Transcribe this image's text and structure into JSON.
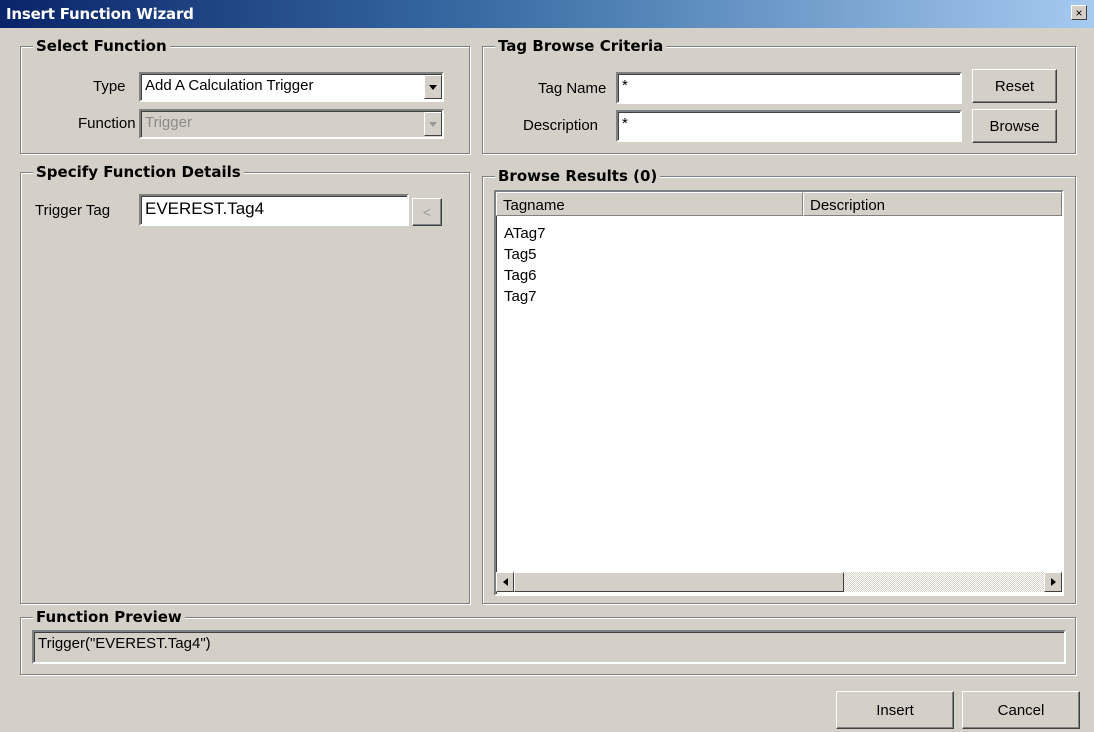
{
  "window": {
    "title": "Insert Function Wizard",
    "close_glyph": "×"
  },
  "select_function": {
    "heading": "Select Function",
    "type_label": "Type",
    "type_value": "Add A Calculation Trigger",
    "function_label": "Function",
    "function_value": "Trigger"
  },
  "tag_browse": {
    "heading": "Tag Browse Criteria",
    "tag_name_label": "Tag Name",
    "tag_name_value": "*",
    "description_label": "Description",
    "description_value": "*",
    "reset_label": "Reset",
    "browse_label": "Browse"
  },
  "function_details": {
    "heading": "Specify Function Details",
    "trigger_tag_label": "Trigger Tag",
    "trigger_tag_value": "EVEREST.Tag4",
    "pick_glyph": "<"
  },
  "browse_results": {
    "heading": "Browse Results (0)",
    "columns": [
      "Tagname",
      "Description"
    ],
    "rows": [
      "ATag7",
      "Tag5",
      "Tag6",
      "Tag7"
    ]
  },
  "preview": {
    "heading": "Function Preview",
    "value": "Trigger(\"EVEREST.Tag4\")"
  },
  "footer": {
    "insert_label": "Insert",
    "cancel_label": "Cancel"
  },
  "colors": {
    "title_bar_start": "#0a246a",
    "title_bar_end": "#a6caf0",
    "dialog_face": "#d4d0c8"
  }
}
